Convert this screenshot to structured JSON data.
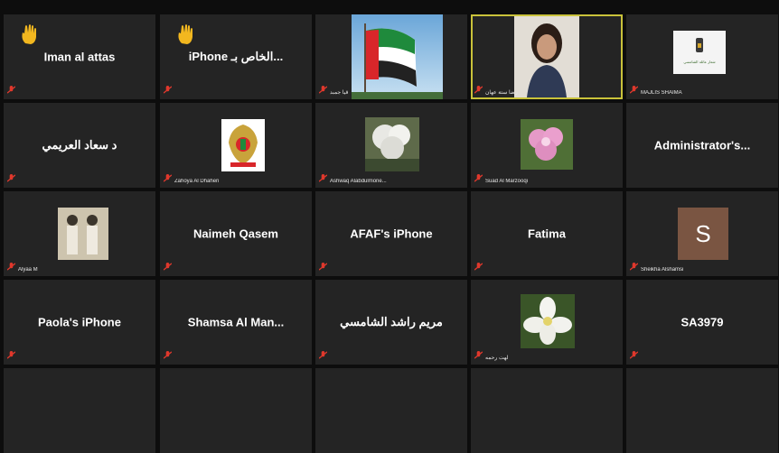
{
  "tiles": [
    {
      "name": "Iman al attas",
      "hand": true
    },
    {
      "name": "iPhone الخاص بـ...",
      "hand": true
    },
    {
      "label": "قيا جمبد"
    },
    {
      "label": "رضا ستة عهان"
    },
    {
      "label": "MAJLIS SHAIMA",
      "logo_text": "شعار عائلة الشامسي"
    },
    {
      "name": "د سعاد العريمي"
    },
    {
      "label": "Zahoya Al Dhaheri"
    },
    {
      "label": "Ashwaq Alabdulmone..."
    },
    {
      "label": "Suad Al Marzooqi"
    },
    {
      "name": "Administrator's..."
    },
    {
      "label": "Alyaa M"
    },
    {
      "name": "Naimeh Qasem"
    },
    {
      "name": "AFAF's iPhone"
    },
    {
      "name": "Fatima"
    },
    {
      "label": "Sheikha Alshamsi",
      "avatar_letter": "S"
    },
    {
      "name": "Paola's iPhone"
    },
    {
      "name": "Shamsa Al Man..."
    },
    {
      "name": "مريم راشد الشامسي"
    },
    {
      "label": "لهت رحمه"
    },
    {
      "name": "SA3979"
    }
  ],
  "colors": {
    "tile_bg": "#242424",
    "active_border": "#c9c23a",
    "hand": "#f2b71f",
    "mute": "#e0382c"
  }
}
